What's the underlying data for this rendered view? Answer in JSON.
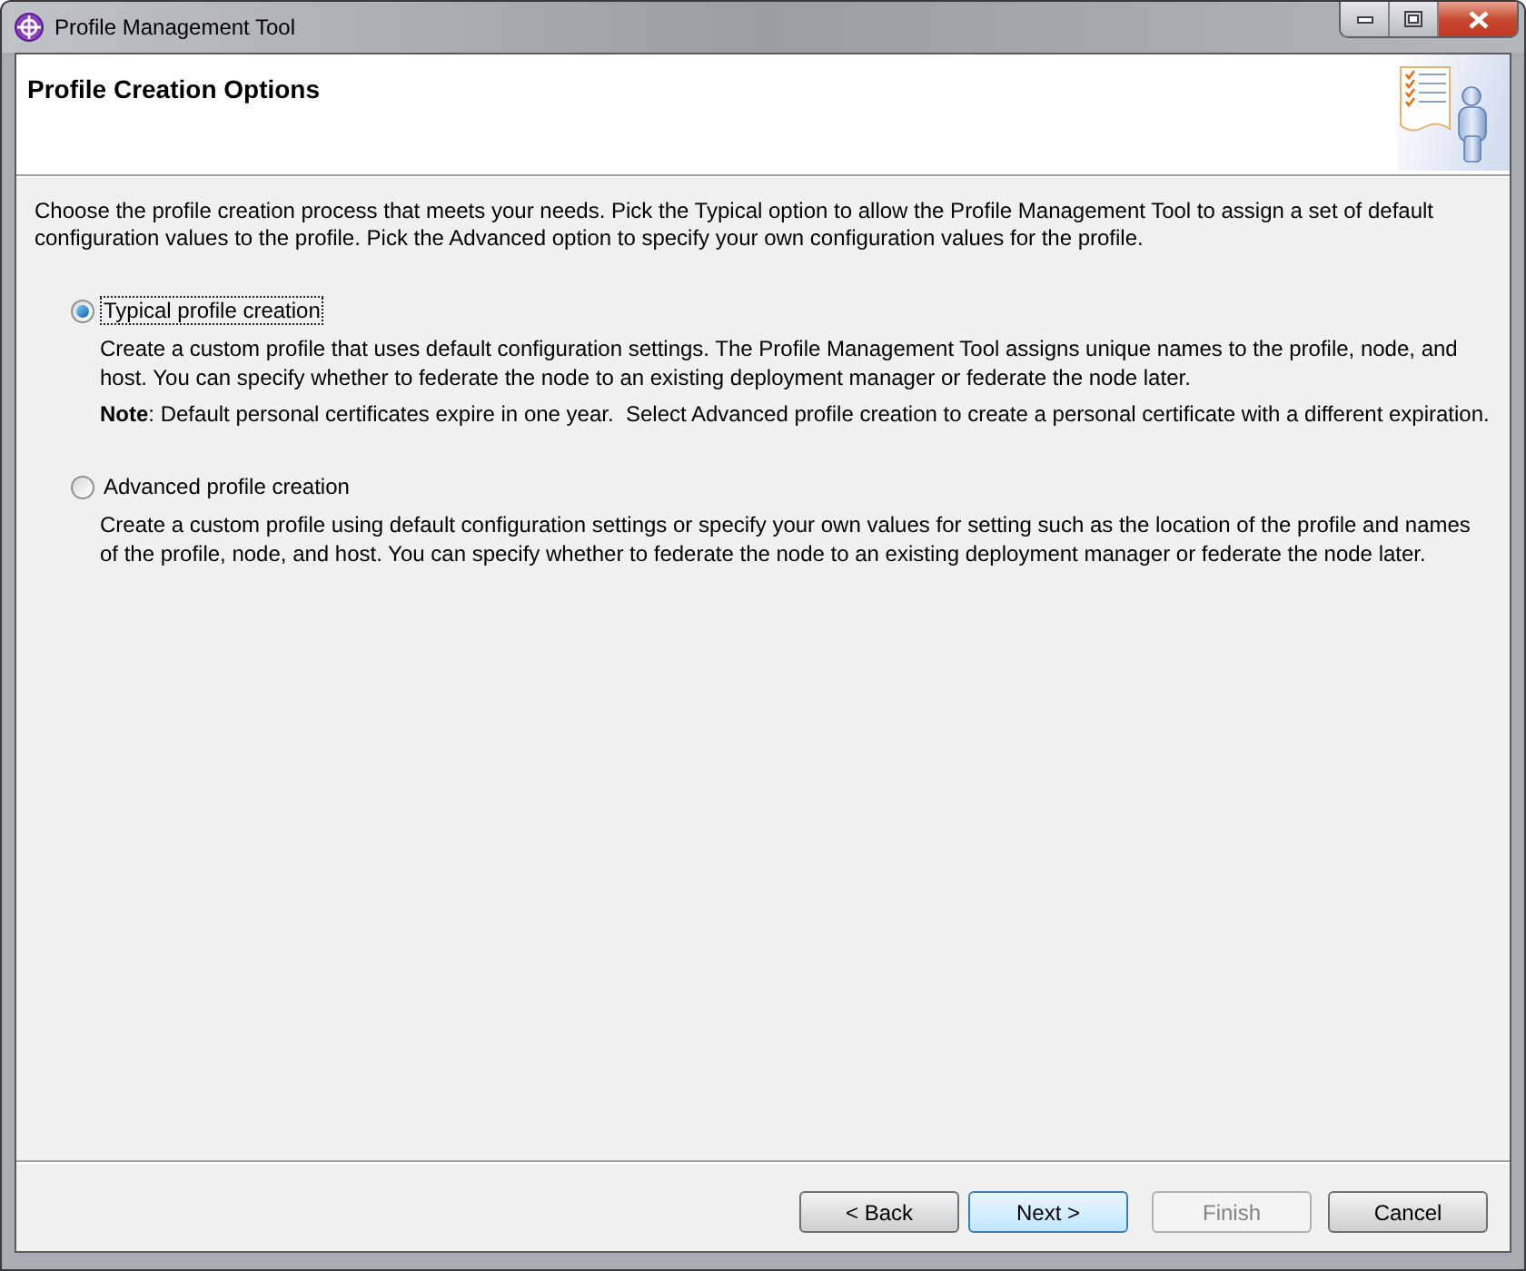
{
  "window": {
    "title": "Profile Management Tool"
  },
  "header": {
    "title": "Profile Creation Options"
  },
  "intro": "Choose the profile creation process that meets your needs. Pick the Typical option to allow the Profile Management Tool to assign a set of default configuration values to the profile. Pick the Advanced option to specify your own configuration values for the profile.",
  "options": [
    {
      "label": "Typical profile creation",
      "selected": true,
      "focused": true,
      "description": "Create a custom profile that uses default configuration settings. The Profile Management Tool assigns unique names to the profile, node, and host. You can specify whether to federate the node to an existing deployment manager or federate the node later.",
      "note": "**Note**: Default personal certificates expire in one year.  Select Advanced profile creation to create a personal certificate with a different expiration."
    },
    {
      "label": "Advanced profile creation",
      "selected": false,
      "focused": false,
      "description": "Create a custom profile using default configuration settings or specify your own values for setting such as the location of the profile and names of the profile, node, and host. You can specify whether to federate the node to an existing deployment manager or federate the node later."
    }
  ],
  "buttons": [
    {
      "label": "< Back",
      "disabled": false,
      "default": false
    },
    {
      "label": "Next >",
      "disabled": false,
      "default": true
    },
    {
      "label": "Finish",
      "disabled": true,
      "default": false
    },
    {
      "label": "Cancel",
      "disabled": false,
      "default": false
    }
  ]
}
